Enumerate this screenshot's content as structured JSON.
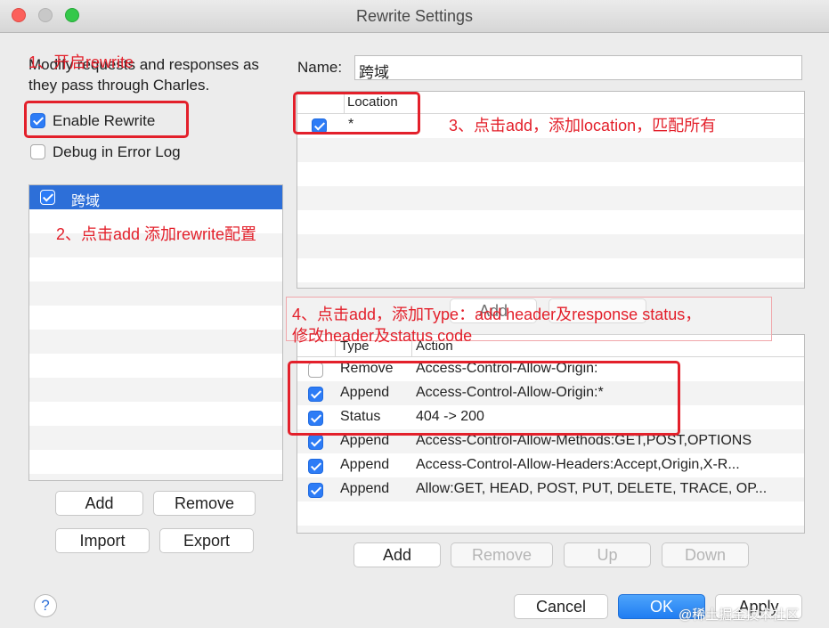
{
  "window": {
    "title": "Rewrite Settings"
  },
  "left": {
    "description": "Modify requests and responses as they pass through Charles.",
    "enable_rewrite": {
      "label": "Enable Rewrite",
      "checked": true
    },
    "debug_log": {
      "label": "Debug in Error Log",
      "checked": false
    },
    "sets": [
      {
        "name": "跨域",
        "checked": true
      }
    ],
    "buttons": {
      "add": "Add",
      "remove": "Remove",
      "import": "Import",
      "export": "Export"
    }
  },
  "right": {
    "name_label": "Name:",
    "name_value": "跨域",
    "locations": {
      "header": "Location",
      "rows": [
        {
          "checked": true,
          "value": "*"
        }
      ]
    },
    "rules": {
      "headers": [
        "Type",
        "Action"
      ],
      "rows": [
        {
          "checked": false,
          "type": "Remove",
          "action": "Access-Control-Allow-Origin:"
        },
        {
          "checked": true,
          "type": "Append",
          "action": "Access-Control-Allow-Origin:*"
        },
        {
          "checked": true,
          "type": "Status",
          "action": "404 -> 200"
        },
        {
          "checked": true,
          "type": "Append",
          "action": "Access-Control-Allow-Methods:GET,POST,OPTIONS"
        },
        {
          "checked": true,
          "type": "Append",
          "action": "Access-Control-Allow-Headers:Accept,Origin,X-R..."
        },
        {
          "checked": true,
          "type": "Append",
          "action": "Allow:GET, HEAD, POST, PUT, DELETE, TRACE, OP..."
        }
      ],
      "hidden_add_label": "Add"
    },
    "buttons": {
      "add": "Add",
      "remove": "Remove",
      "up": "Up",
      "down": "Down"
    }
  },
  "footer": {
    "help": "?",
    "cancel": "Cancel",
    "ok": "OK",
    "apply": "Apply"
  },
  "annotations": {
    "step1": "1、开启rewrite",
    "step2": "2、点击add 添加rewrite配置",
    "step3": "3、点击add，添加location，匹配所有",
    "step4_line1": "4、点击add，添加Type：add header及response status，",
    "step4_line2": "修改header及status code"
  },
  "watermark": "@稀土掘金技术社区",
  "colors": {
    "accent": "#2d7cf6",
    "annotation": "#e3202b",
    "selection": "#2d6fd8"
  }
}
